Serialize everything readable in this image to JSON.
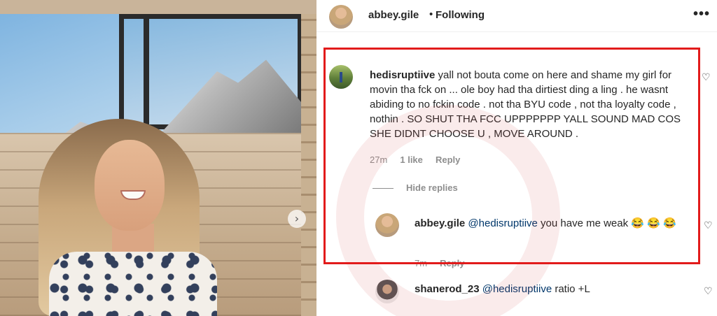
{
  "post": {
    "author": "abbey.gile",
    "dot": "•",
    "follow_status": "Following",
    "more_icon": "•••",
    "next_icon": "›"
  },
  "comments": [
    {
      "username": "hedisruptiive",
      "text": "yall not bouta come on here and shame my girl for movin tha fck on ... ole boy had tha dirtiest ding a ling . he wasnt abiding to no fckin code . not tha BYU code , not tha loyalty code , nothin . SO SHUT THA FCC UPPPPPPP YALL SOUND MAD COS SHE DIDNT CHOOSE U , MOVE AROUND .",
      "time": "27m",
      "likes": "1 like",
      "reply_label": "Reply",
      "hide_replies": "Hide replies",
      "replies": [
        {
          "username": "abbey.gile",
          "mention": "@hedisruptiive",
          "text": " you have me weak 😂 😂 😂",
          "time": "7m",
          "reply_label": "Reply"
        }
      ]
    },
    {
      "username": "shanerod_23",
      "mention": "@hedisruptiive",
      "text": " ratio +L"
    }
  ],
  "icons": {
    "heart": "♡"
  },
  "colors": {
    "highlight_box": "#e21b1b",
    "mention": "#00376b",
    "meta_text": "#8e8e8e"
  }
}
